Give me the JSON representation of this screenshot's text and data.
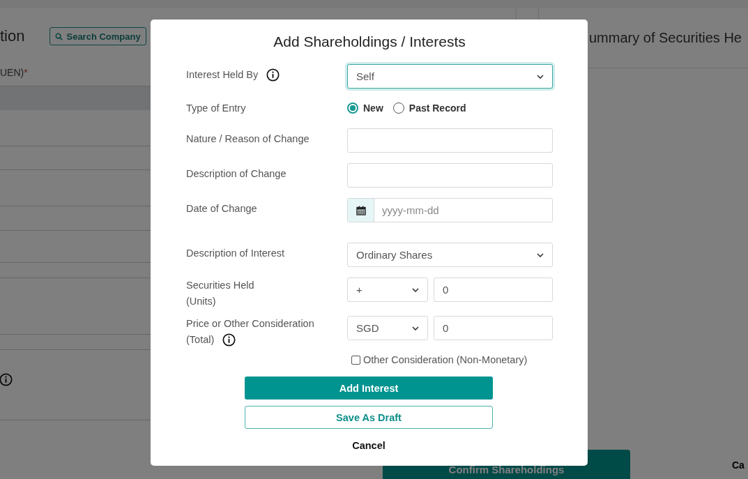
{
  "background": {
    "left_panel": {
      "title": "tion",
      "search_button": "Search Company",
      "field_label": "UEN)",
      "required_mark": "*"
    },
    "right_panel": {
      "title": "ummary of Securities He"
    },
    "confirm_button": "Confirm Shareholdings",
    "cancel_link": "Ca"
  },
  "modal": {
    "title": "Add Shareholdings / Interests",
    "fields": [
      {
        "kind": "select",
        "label": "Interest Held By",
        "info": true,
        "value": "Self",
        "focused": true
      },
      {
        "kind": "radio",
        "label": "Type of Entry",
        "info": false,
        "options": [
          {
            "label": "New",
            "selected": true
          },
          {
            "label": "Past Record",
            "selected": false
          }
        ]
      },
      {
        "kind": "text",
        "label": "Nature / Reason of Change",
        "info": false
      },
      {
        "kind": "text",
        "label": "Description of Change",
        "info": false
      },
      {
        "kind": "date",
        "label": "Date of Change",
        "info": false,
        "placeholder": "yyyy-mm-dd"
      },
      {
        "kind": "select",
        "label": "Description of Interest",
        "info": false,
        "value": "Ordinary Shares",
        "focused": false
      },
      {
        "kind": "split",
        "label": "Securities Held",
        "sublabel": "(Units)",
        "info": false,
        "select": "+",
        "value": "0"
      },
      {
        "kind": "split",
        "label": "Price or Other Consideration",
        "sublabel": "(Total)",
        "info": true,
        "select": "SGD",
        "value": "0"
      }
    ],
    "checkbox": {
      "label": "Other Consideration (Non-Monetary)",
      "checked": false
    },
    "buttons": [
      {
        "kind": "primary",
        "label": "Add Interest"
      },
      {
        "kind": "outline",
        "label": "Save As Draft"
      },
      {
        "kind": "link",
        "label": "Cancel"
      }
    ]
  }
}
